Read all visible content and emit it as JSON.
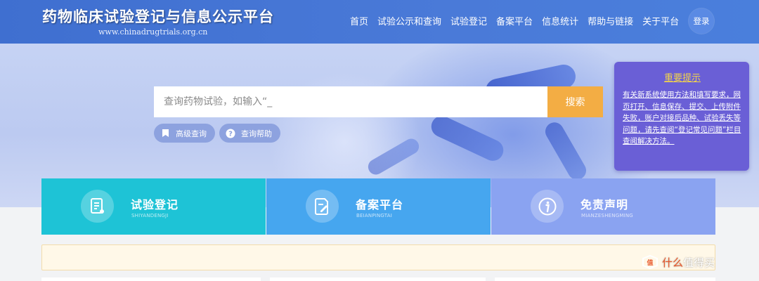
{
  "header": {
    "title": "药物临床试验登记与信息公示平台",
    "url": "www.chinadrugtrials.org.cn",
    "nav": [
      "首页",
      "试验公示和查询",
      "试验登记",
      "备案平台",
      "信息统计",
      "帮助与链接",
      "关于平台"
    ],
    "login_label": "登录"
  },
  "search": {
    "placeholder": "查询药物试验，如输入“_",
    "button_label": "搜索",
    "advanced_label": "高级查询",
    "help_label": "查询帮助"
  },
  "notice": {
    "title": "重要提示",
    "body": "有关新系统使用方法和填写要求，网页打开、信息保存、提交、上传附件失败，账户对接后品种、试验丢失等问题，请先查阅“登记常见问题”栏目查阅解决方法。"
  },
  "cards": [
    {
      "title": "试验登记",
      "subtitle": "SHIYANDENGJI",
      "color": "#1ec3d6",
      "icon": "document-edit-icon"
    },
    {
      "title": "备案平台",
      "subtitle": "BEIANPINGTAI",
      "color": "#46a6ef",
      "icon": "file-pen-icon"
    },
    {
      "title": "免责声明",
      "subtitle": "MIANZESHENGMING",
      "color": "#8aa3f1",
      "icon": "info-icon"
    }
  ],
  "watermark": {
    "prefix": "值",
    "middle": "什么",
    "suffix": "值得买"
  }
}
